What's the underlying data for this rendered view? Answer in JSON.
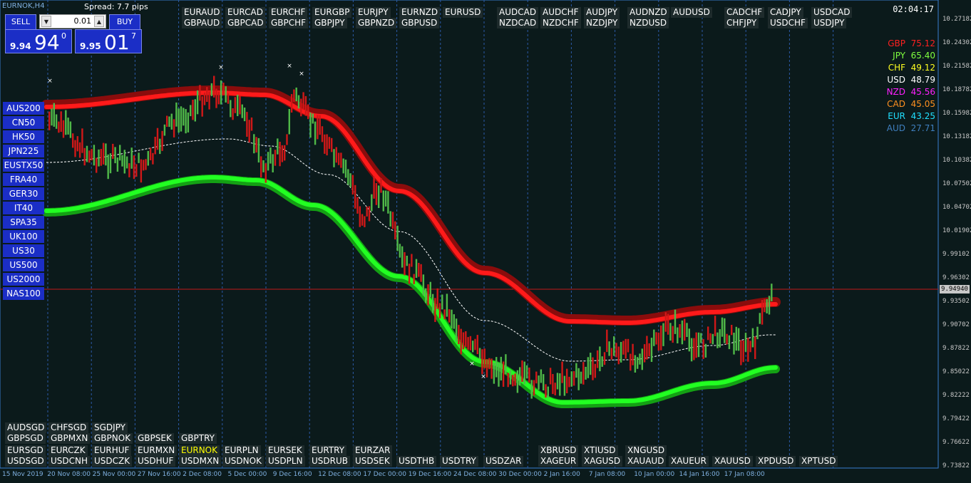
{
  "window": {
    "title": "EURNOK,H4",
    "spread": "Spread: 7.7 pips",
    "clock": "02:04:17"
  },
  "trade": {
    "sell_label": "SELL",
    "buy_label": "BUY",
    "lot": "0.01",
    "bid": {
      "small": "9.94",
      "big": "94",
      "sup": "0"
    },
    "ask": {
      "small": "9.95",
      "big": "01",
      "sup": "7"
    }
  },
  "top_symbols": [
    [
      "EURAUD",
      "EURCAD",
      "EURCHF",
      "EURGBP",
      "EURJPY",
      "EURNZD",
      "EURUSD"
    ],
    [
      "GBPAUD",
      "GBPCAD",
      "GBPCHF",
      "GBPJPY",
      "GBPNZD",
      "GBPUSD"
    ],
    [
      "AUDCAD",
      "AUDCHF",
      "AUDJPY",
      "AUDNZD",
      "AUDUSD"
    ],
    [
      "NZDCAD",
      "NZDCHF",
      "NZDJPY",
      "NZDUSD"
    ],
    [
      "CADCHF",
      "CADJPY",
      "USDCAD"
    ],
    [
      "CHFJPY",
      "USDCHF",
      "USDJPY"
    ]
  ],
  "indices": [
    "AUS200",
    "CN50",
    "HK50",
    "JPN225",
    "EUSTX50",
    "FRA40",
    "GER30",
    "IT40",
    "SPA35",
    "UK100",
    "US30",
    "US500",
    "US2000",
    "NAS100"
  ],
  "bottom_symbols": [
    [
      "AUDSGD",
      "CHFSGD",
      "SGDJPY"
    ],
    [
      "GBPSGD",
      "GBPMXN",
      "GBPNOK",
      "GBPSEK",
      "GBPTRY"
    ],
    [
      "EURSGD",
      "EURCZK",
      "EURHUF",
      "EURMXN",
      "EURNOK",
      "EURPLN",
      "EURSEK",
      "EURTRY",
      "EURZAR"
    ],
    [
      "USDSGD",
      "USDCNH",
      "USDCZK",
      "USDHUF",
      "USDMXN",
      "USDNOK",
      "USDPLN",
      "USDRUB",
      "USDSEK",
      "USDTHB",
      "USDTRY",
      "USDZAR"
    ],
    [
      "XBRUSD",
      "XTIUSD",
      "XNGUSD"
    ],
    [
      "XAGEUR",
      "XAGUSD",
      "XAUAUD",
      "XAUEUR",
      "XAUUSD",
      "XPDUSD",
      "XPTUSD"
    ]
  ],
  "highlight_symbol": "EURNOK",
  "strength": [
    {
      "name": "GBP",
      "value": "75.12",
      "color": "#ff2020"
    },
    {
      "name": "JPY",
      "value": "65.40",
      "color": "#7fff3f"
    },
    {
      "name": "CHF",
      "value": "49.12",
      "color": "#ffff20"
    },
    {
      "name": "USD",
      "value": "48.79",
      "color": "#ffffff"
    },
    {
      "name": "NZD",
      "value": "45.56",
      "color": "#ff20ff"
    },
    {
      "name": "CAD",
      "value": "45.05",
      "color": "#ff9020"
    },
    {
      "name": "EUR",
      "value": "43.25",
      "color": "#20e0ff"
    },
    {
      "name": "AUD",
      "value": "27.71",
      "color": "#3f7fbf"
    }
  ],
  "price_axis": [
    "10.27182",
    "10.24302",
    "10.21582",
    "10.18782",
    "10.15982",
    "10.13182",
    "10.10382",
    "10.07502",
    "10.04702",
    "10.01902",
    "9.99102",
    "9.96302",
    "9.93502",
    "9.90702",
    "9.87822",
    "9.85022",
    "9.82222",
    "9.79422",
    "9.76622",
    "9.73822"
  ],
  "current_price": "9.94940",
  "date_axis": [
    "15 Nov 2019",
    "20 Nov 08:00",
    "25 Nov 00:00",
    "27 Nov 16:00",
    "2 Dec 08:00",
    "5 Dec 00:00",
    "9 Dec 16:00",
    "12 Dec 08:00",
    "17 Dec 00:00",
    "19 Dec 16:00",
    "24 Dec 08:00",
    "30 Dec 00:00",
    "2 Jan 16:00",
    "7 Jan 08:00",
    "10 Jan 00:00",
    "14 Jan 16:00",
    "17 Jan 08:00"
  ],
  "colors": {
    "bull": "#4fb848",
    "bear": "#d01818",
    "upper_band": "#ff1a1a",
    "lower_band": "#22ff22",
    "grid": "#2b5aa8"
  }
}
